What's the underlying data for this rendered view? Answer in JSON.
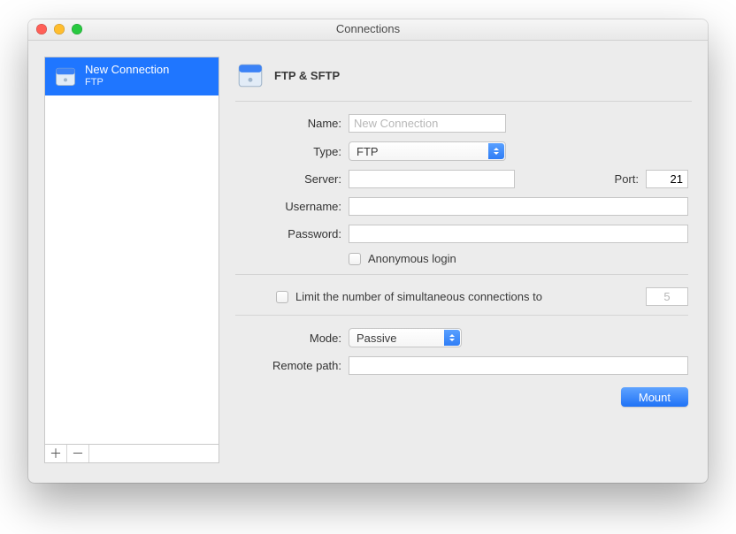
{
  "window": {
    "title": "Connections"
  },
  "sidebar": {
    "items": [
      {
        "title": "New Connection",
        "subtitle": "FTP"
      }
    ],
    "add_glyph": "＋",
    "remove_glyph": "－"
  },
  "pane": {
    "title": "FTP & SFTP"
  },
  "labels": {
    "name": "Name:",
    "type": "Type:",
    "server": "Server:",
    "port": "Port:",
    "username": "Username:",
    "password": "Password:",
    "anonymous": "Anonymous login",
    "limit": "Limit the number of simultaneous connections to",
    "mode": "Mode:",
    "remote_path": "Remote path:"
  },
  "values": {
    "name_placeholder": "New Connection",
    "type_selected": "FTP",
    "server": "",
    "port": "21",
    "username": "",
    "password": "",
    "anonymous_checked": false,
    "limit_checked": false,
    "limit_value_placeholder": "5",
    "mode_selected": "Passive",
    "remote_path": ""
  },
  "buttons": {
    "mount": "Mount"
  }
}
